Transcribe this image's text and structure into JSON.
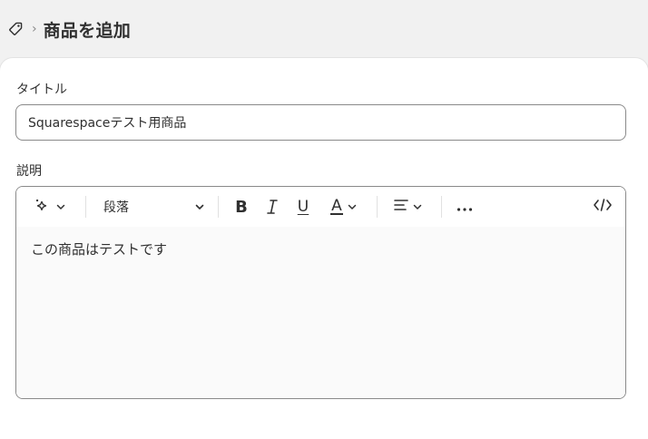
{
  "header": {
    "breadcrumb_separator": "›",
    "title": "商品を追加",
    "icon": "tag-icon"
  },
  "form": {
    "title_label": "タイトル",
    "title_value": "Squarespaceテスト用商品",
    "description_label": "説明"
  },
  "editor": {
    "toolbar": {
      "ai_icon": "sparkle-icon",
      "paragraph_label": "段落",
      "bold_label": "B",
      "italic_label": "I",
      "underline_label": "U",
      "text_color_label": "A",
      "align_icon": "align-left-icon",
      "more_icon": "more-horizontal-icon",
      "code_label": "</>"
    },
    "content": "この商品はテストです"
  }
}
